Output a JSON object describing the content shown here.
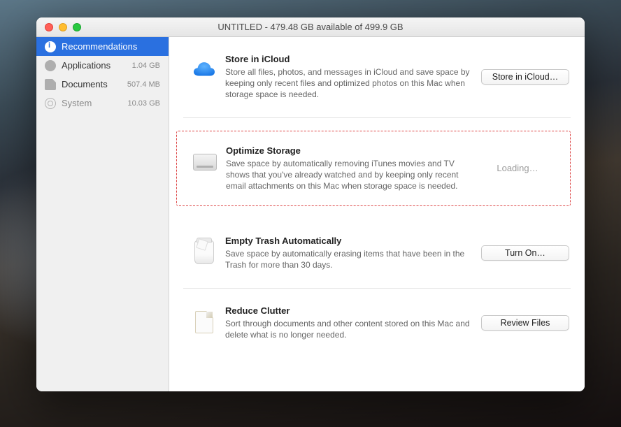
{
  "window": {
    "title": "UNTITLED - 479.48 GB available of 499.9 GB"
  },
  "sidebar": {
    "items": [
      {
        "label": "Recommendations",
        "size": "",
        "selected": true,
        "icon": "recommendations-icon"
      },
      {
        "label": "Applications",
        "size": "1.04 GB",
        "selected": false,
        "icon": "applications-icon"
      },
      {
        "label": "Documents",
        "size": "507.4 MB",
        "selected": false,
        "icon": "documents-icon"
      },
      {
        "label": "System",
        "size": "10.03 GB",
        "selected": false,
        "icon": "system-icon",
        "dimmed": true
      }
    ]
  },
  "sections": [
    {
      "id": "icloud",
      "title": "Store in iCloud",
      "desc": "Store all files, photos, and messages in iCloud and save space by keeping only recent files and optimized photos on this Mac when storage space is needed.",
      "button": "Store in iCloud…",
      "highlighted": false
    },
    {
      "id": "optimize",
      "title": "Optimize Storage",
      "desc": "Save space by automatically removing iTunes movies and TV shows that you've already watched and by keeping only recent email attachments on this Mac when storage space is needed.",
      "loading": "Loading…",
      "highlighted": true
    },
    {
      "id": "trash",
      "title": "Empty Trash Automatically",
      "desc": "Save space by automatically erasing items that have been in the Trash for more than 30 days.",
      "button": "Turn On…",
      "highlighted": false
    },
    {
      "id": "clutter",
      "title": "Reduce Clutter",
      "desc": "Sort through documents and other content stored on this Mac and delete what is no longer needed.",
      "button": "Review Files",
      "highlighted": false
    }
  ]
}
